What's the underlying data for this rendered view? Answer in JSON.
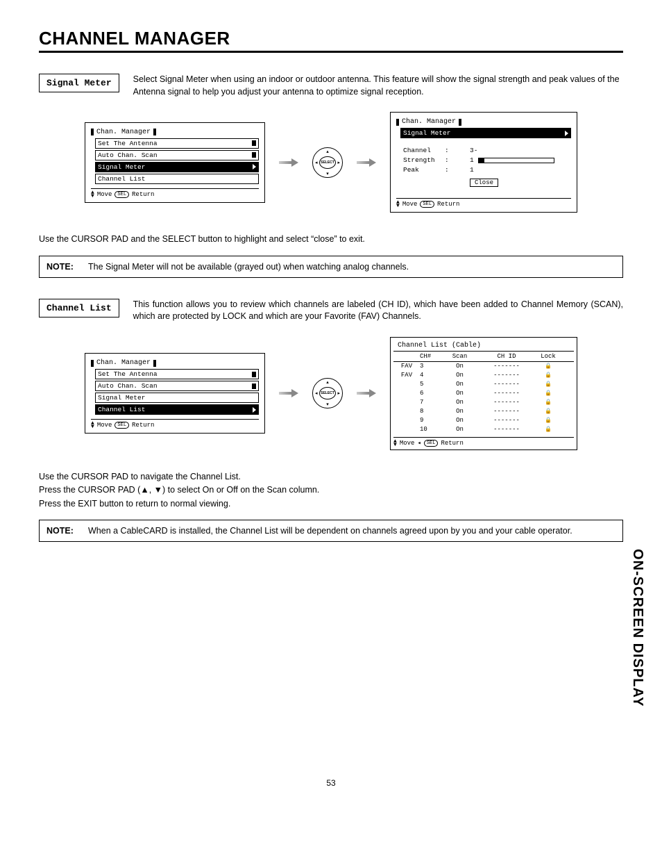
{
  "page": {
    "title": "CHANNEL MANAGER",
    "side_label": "ON-SCREEN DISPLAY",
    "number": "53"
  },
  "signal_meter": {
    "label": "Signal Meter",
    "desc": "Select Signal Meter when using an indoor or outdoor antenna.  This feature will show the signal strength and peak values of the Antenna signal to help  you adjust your antenna to optimize signal reception.",
    "exit_instr": "Use the CURSOR PAD and the SELECT button to highlight and select “close” to exit.",
    "note_label": "NOTE:",
    "note_text": "The Signal Meter will not be available (grayed out) when watching analog channels.",
    "menu": {
      "title": "Chan. Manager",
      "items": [
        "Set The Antenna",
        "Auto Chan. Scan",
        "Signal Meter",
        "Channel List"
      ],
      "highlight": "Signal Meter",
      "foot_move": "Move",
      "foot_sel": "SEL",
      "foot_return": "Return"
    },
    "remote_label": "SELECT",
    "result": {
      "title": "Chan. Manager",
      "sub": "Signal Meter",
      "channel_lbl": "Channel",
      "channel_val": "3-",
      "strength_lbl": "Strength",
      "strength_val": "1",
      "peak_lbl": "Peak",
      "peak_val": "1",
      "close": "Close",
      "colon": ":",
      "foot_move": "Move",
      "foot_sel": "SEL",
      "foot_return": "Return"
    }
  },
  "channel_list": {
    "label": "Channel List",
    "desc": "This function allows you to review which channels are labeled (CH ID), which have been added to Channel Memory (SCAN), which are protected by LOCK and which are your Favorite (FAV) Channels.",
    "instr1": "Use the CURSOR PAD to navigate the Channel List.",
    "instr2": "Press the CURSOR PAD (▲, ▼) to select On or Off on the Scan column.",
    "instr3": "Press the EXIT button to return to normal viewing.",
    "note_label": "NOTE:",
    "note_text": "When a CableCARD is installed, the Channel List will be dependent on channels agreed upon by you and your cable operator.",
    "menu": {
      "title": "Chan. Manager",
      "items": [
        "Set The Antenna",
        "Auto Chan. Scan",
        "Signal Meter",
        "Channel List"
      ],
      "highlight": "Channel List",
      "foot_move": "Move",
      "foot_sel": "SEL",
      "foot_return": "Return"
    },
    "remote_label": "SELECT",
    "result": {
      "title": "Channel List (Cable)",
      "hdr": {
        "ch": "CH#",
        "scan": "Scan",
        "id": "CH ID",
        "lock": "Lock"
      },
      "rows": [
        {
          "fav": "FAV",
          "ch": "3",
          "scan": "On",
          "id": "-------",
          "lock": true
        },
        {
          "fav": "FAV",
          "ch": "4",
          "scan": "On",
          "id": "-------",
          "lock": true
        },
        {
          "fav": "",
          "ch": "5",
          "scan": "On",
          "id": "-------",
          "lock": true
        },
        {
          "fav": "",
          "ch": "6",
          "scan": "On",
          "id": "-------",
          "lock": true
        },
        {
          "fav": "",
          "ch": "7",
          "scan": "On",
          "id": "-------",
          "lock": true
        },
        {
          "fav": "",
          "ch": "8",
          "scan": "On",
          "id": "-------",
          "lock": true
        },
        {
          "fav": "",
          "ch": "9",
          "scan": "On",
          "id": "-------",
          "lock": true
        },
        {
          "fav": "",
          "ch": "10",
          "scan": "On",
          "id": "-------",
          "lock": true
        }
      ],
      "foot_move": "Move",
      "foot_sel": "SEL",
      "foot_return": "Return"
    }
  }
}
